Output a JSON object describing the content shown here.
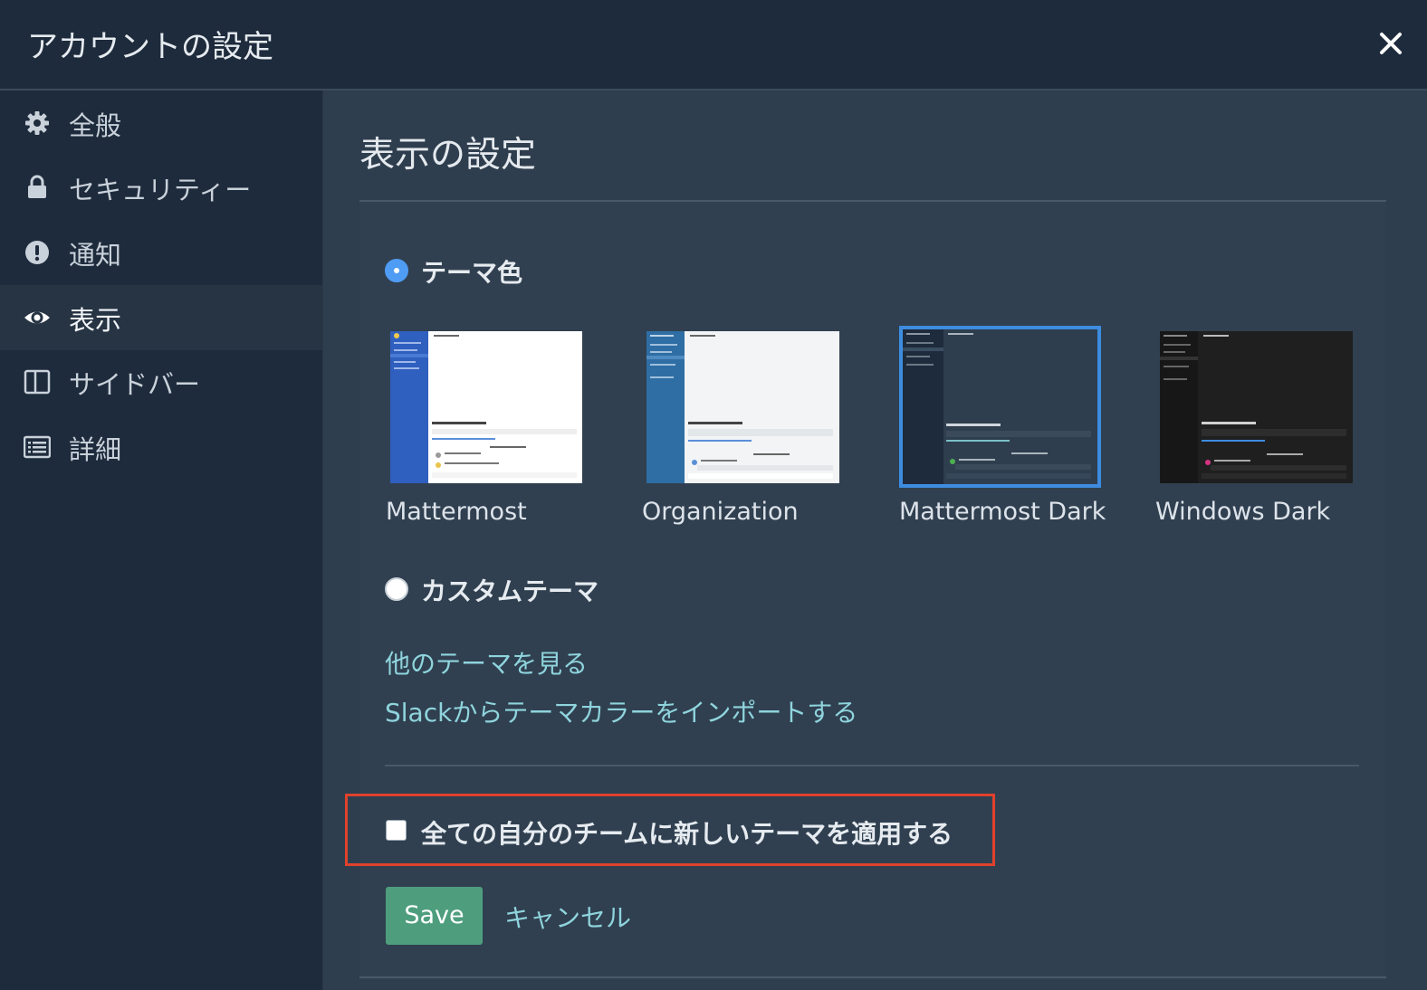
{
  "header": {
    "title": "アカウントの設定"
  },
  "sidebar": {
    "items": [
      {
        "label": "全般",
        "icon": "gear-icon",
        "active": false
      },
      {
        "label": "セキュリティー",
        "icon": "lock-icon",
        "active": false
      },
      {
        "label": "通知",
        "icon": "alert-icon",
        "active": false
      },
      {
        "label": "表示",
        "icon": "eye-icon",
        "active": true
      },
      {
        "label": "サイドバー",
        "icon": "columns-icon",
        "active": false
      },
      {
        "label": "詳細",
        "icon": "list-icon",
        "active": false
      }
    ]
  },
  "main": {
    "title": "表示の設定",
    "theme_colors_label": "テーマ色",
    "custom_theme_label": "カスタムテーマ",
    "themes": [
      {
        "name": "Mattermost",
        "selected": false
      },
      {
        "name": "Organization",
        "selected": false
      },
      {
        "name": "Mattermost Dark",
        "selected": true
      },
      {
        "name": "Windows Dark",
        "selected": false
      }
    ],
    "more_themes_link": "他のテーマを見る",
    "import_slack_link": "Slackからテーマカラーをインポートする",
    "apply_all_teams_label": "全ての自分のチームに新しいテーマを適用する",
    "apply_all_teams_checked": false,
    "save_label": "Save",
    "cancel_label": "キャンセル"
  },
  "colors": {
    "accent": "#4f9cf5",
    "link": "#8fd4dd",
    "save": "#4e9e7e",
    "highlight": "#e0412c"
  }
}
